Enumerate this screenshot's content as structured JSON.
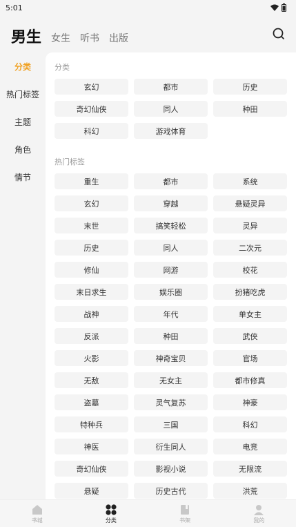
{
  "status_bar": {
    "time": "5:01",
    "wifi_icon": "wifi-icon",
    "battery_icon": "battery-icon"
  },
  "header": {
    "tabs": [
      {
        "label": "男生",
        "active": true
      },
      {
        "label": "女生",
        "active": false
      },
      {
        "label": "听书",
        "active": false
      },
      {
        "label": "出版",
        "active": false
      }
    ],
    "search_icon": "search-icon"
  },
  "sidebar": {
    "items": [
      {
        "label": "分类",
        "active": true
      },
      {
        "label": "热门标签",
        "active": false
      },
      {
        "label": "主题",
        "active": false
      },
      {
        "label": "角色",
        "active": false
      },
      {
        "label": "情节",
        "active": false
      }
    ]
  },
  "sections": [
    {
      "title": "分类",
      "tags": [
        "玄幻",
        "都市",
        "历史",
        "奇幻仙侠",
        "同人",
        "种田",
        "科幻",
        "游戏体育"
      ]
    },
    {
      "title": "热门标签",
      "tags": [
        "重生",
        "都市",
        "系统",
        "玄幻",
        "穿越",
        "悬疑灵异",
        "末世",
        "搞笑轻松",
        "灵异",
        "历史",
        "同人",
        "二次元",
        "修仙",
        "网游",
        "校花",
        "末日求生",
        "娱乐圈",
        "扮猪吃虎",
        "战神",
        "年代",
        "单女主",
        "反派",
        "种田",
        "武侠",
        "火影",
        "神奇宝贝",
        "官场",
        "无敌",
        "无女主",
        "都市修真",
        "盗墓",
        "灵气复苏",
        "神豪",
        "特种兵",
        "三国",
        "科幻",
        "神医",
        "衍生同人",
        "电竞",
        "奇幻仙侠",
        "影视小说",
        "无限流",
        "悬疑",
        "历史古代",
        "洪荒"
      ]
    }
  ],
  "bottom_nav": {
    "items": [
      {
        "label": "书城",
        "icon": "home-icon",
        "active": false
      },
      {
        "label": "分类",
        "icon": "category-icon",
        "active": true
      },
      {
        "label": "书架",
        "icon": "bookshelf-icon",
        "active": false
      },
      {
        "label": "我的",
        "icon": "profile-icon",
        "active": false
      }
    ]
  },
  "colors": {
    "accent": "#f0a020",
    "tag_bg": "#f4f4f4",
    "page_bg": "#f4f4f4"
  }
}
